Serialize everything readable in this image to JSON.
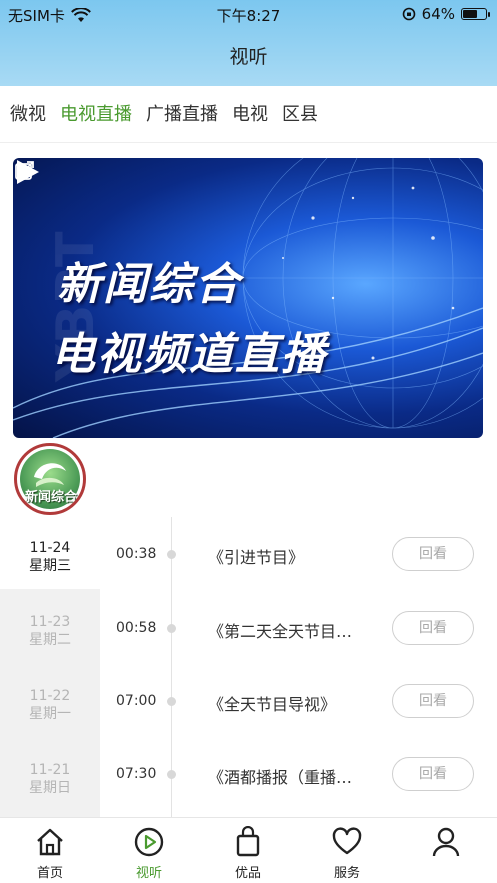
{
  "status_bar": {
    "carrier": "无SIM卡",
    "time": "下午8:27",
    "battery_percent": "64%",
    "battery_level": 0.64
  },
  "header": {
    "title": "视听"
  },
  "tabs": [
    {
      "label": "微视",
      "active": false
    },
    {
      "label": "电视直播",
      "active": true
    },
    {
      "label": "广播直播",
      "active": false
    },
    {
      "label": "电视",
      "active": false
    },
    {
      "label": "区县",
      "active": false
    }
  ],
  "banner": {
    "line1": "新闻综合",
    "line2": "电视频道直播"
  },
  "channel": {
    "logo_text": "新闻综合"
  },
  "dates": [
    {
      "date": "11-24",
      "weekday": "星期三",
      "active": true
    },
    {
      "date": "11-23",
      "weekday": "星期二",
      "active": false
    },
    {
      "date": "11-22",
      "weekday": "星期一",
      "active": false
    },
    {
      "date": "11-21",
      "weekday": "星期日",
      "active": false
    }
  ],
  "programs": [
    {
      "time": "00:38",
      "title": "《引进节目》",
      "action": "回看"
    },
    {
      "time": "00:58",
      "title": "《第二天全天节目…",
      "action": "回看"
    },
    {
      "time": "07:00",
      "title": "《全天节目导视》",
      "action": "回看"
    },
    {
      "time": "07:30",
      "title": "《酒都播报（重播…",
      "action": "回看"
    }
  ],
  "bottom_nav": [
    {
      "label": "首页",
      "icon": "home-icon",
      "active": false
    },
    {
      "label": "视听",
      "icon": "play-circle-icon",
      "active": true
    },
    {
      "label": "优品",
      "icon": "shopping-bag-icon",
      "active": false
    },
    {
      "label": "服务",
      "icon": "heart-icon",
      "active": false
    },
    {
      "label": "",
      "icon": "user-icon",
      "active": false
    }
  ],
  "colors": {
    "accent_green": "#4a9a2f",
    "header_blue": "#7cc7ef"
  }
}
